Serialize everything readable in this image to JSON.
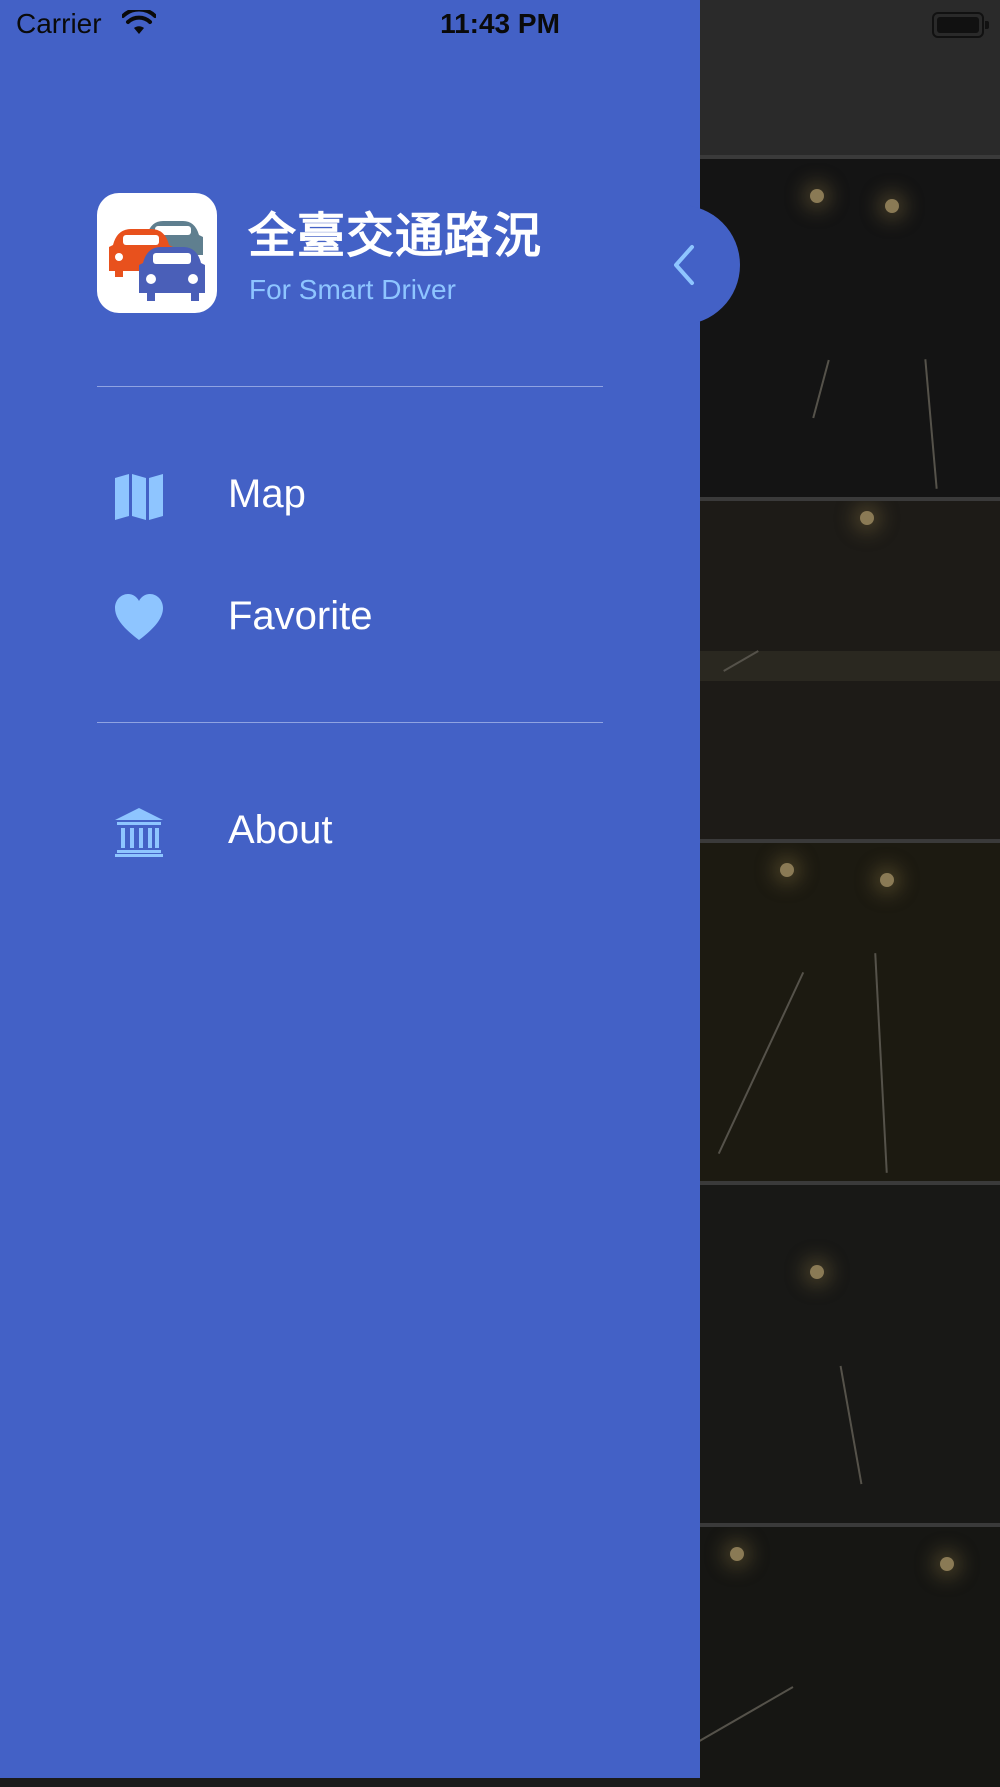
{
  "status_bar": {
    "carrier": "Carrier",
    "time": "11:43 PM"
  },
  "drawer": {
    "app_title": "全臺交通路況",
    "app_subtitle": "For Smart Driver",
    "menu": [
      {
        "label": "Map",
        "icon": "map-icon"
      },
      {
        "label": "Favorite",
        "icon": "heart-icon"
      }
    ],
    "secondary_menu": [
      {
        "label": "About",
        "icon": "bank-icon"
      }
    ]
  },
  "colors": {
    "drawer_bg": "#4361c6",
    "icon_accent": "#8ec5ff",
    "divider": "#8fa3e2"
  }
}
